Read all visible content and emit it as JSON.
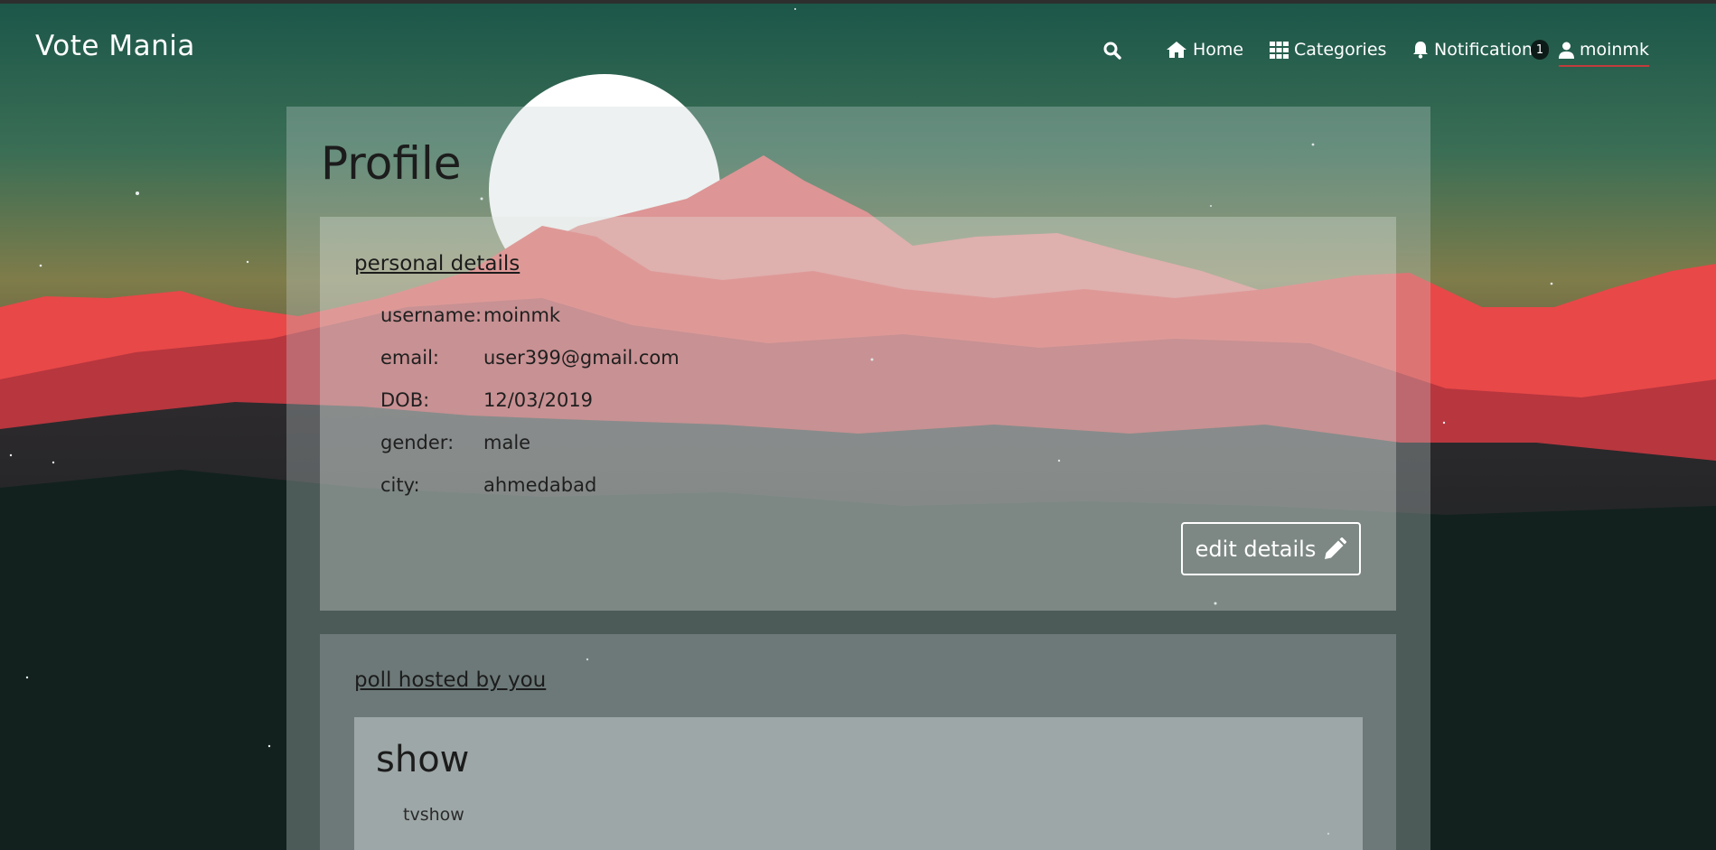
{
  "brand": "Vote Mania",
  "nav": {
    "home": "Home",
    "categories": "Categories",
    "notification": "Notification",
    "notification_count": "1",
    "user": "moinmk"
  },
  "page_title": "Profile",
  "personal": {
    "heading": "personal details",
    "rows": [
      {
        "label": "username:",
        "value": "moinmk"
      },
      {
        "label": "email:",
        "value": "user399@gmail.com"
      },
      {
        "label": "DOB:",
        "value": "12/03/2019"
      },
      {
        "label": "gender:",
        "value": "male"
      },
      {
        "label": "city:",
        "value": "ahmedabad"
      }
    ],
    "edit_label": "edit details"
  },
  "polls": {
    "heading": "poll hosted by you",
    "items": [
      {
        "title": "show",
        "category": "tvshow"
      }
    ]
  },
  "colors": {
    "sky_top": "#1e5a4c",
    "mountain_red": "#e84a4a",
    "mountain_pink": "#f09a9a",
    "underline_active": "#c23b3b"
  }
}
